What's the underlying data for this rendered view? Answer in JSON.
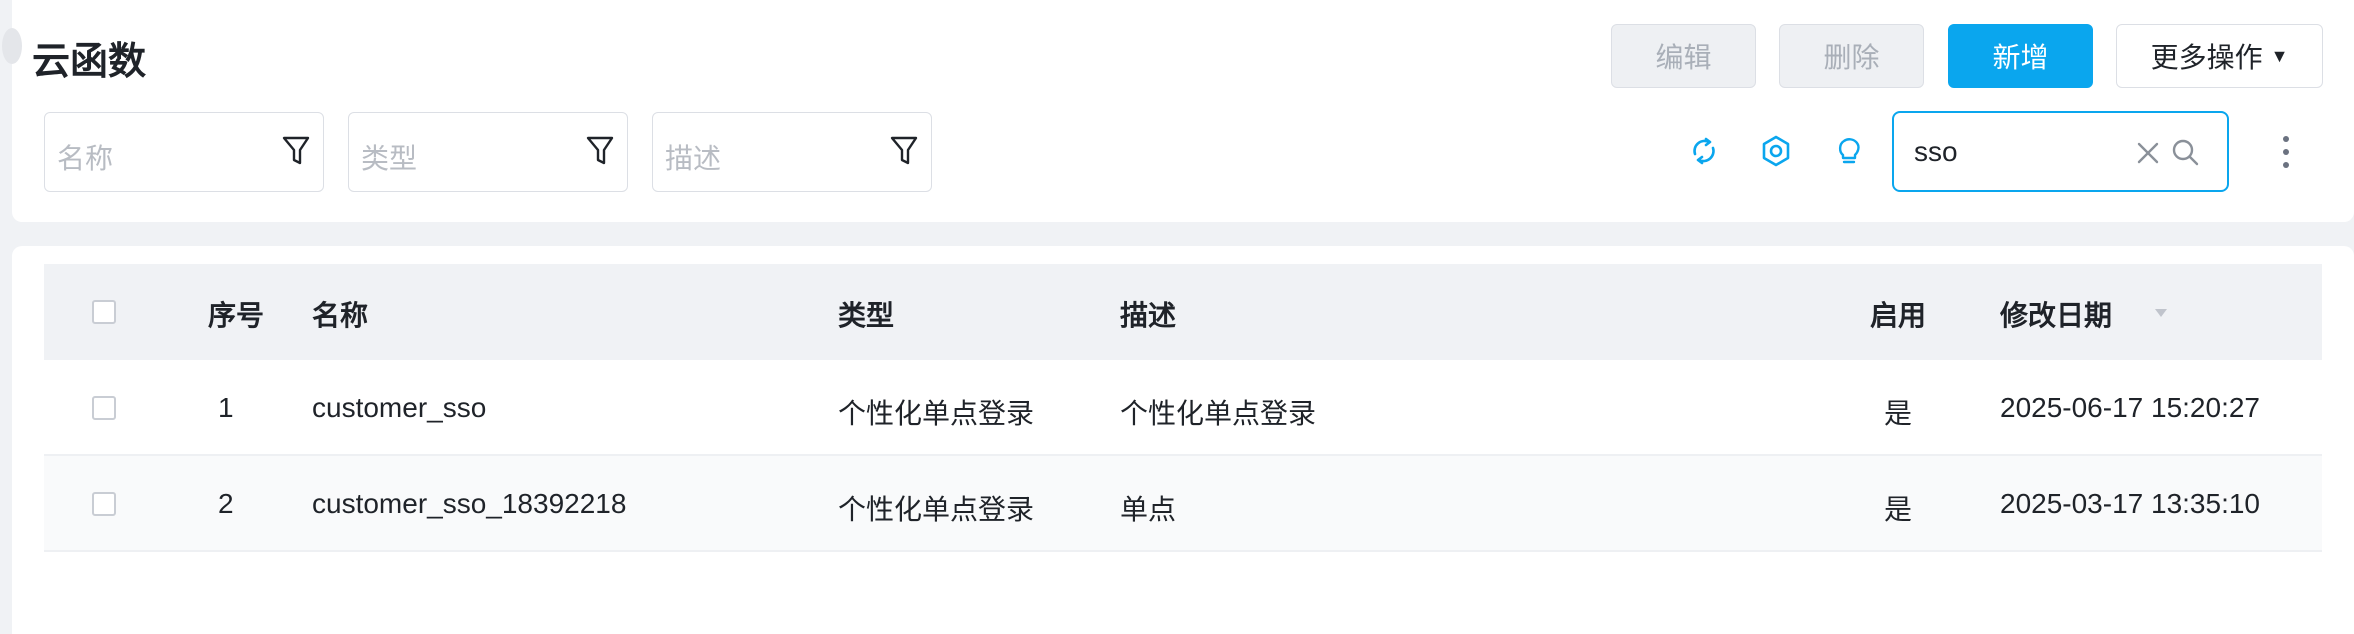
{
  "page": {
    "title": "云函数"
  },
  "toolbar": {
    "edit_label": "编辑",
    "delete_label": "删除",
    "add_label": "新增",
    "more_label": "更多操作",
    "more_caret": "▼"
  },
  "filters": [
    {
      "placeholder": "名称",
      "icon": "filter-icon"
    },
    {
      "placeholder": "类型",
      "icon": "filter-icon"
    },
    {
      "placeholder": "描述",
      "icon": "filter-icon"
    }
  ],
  "tools": {
    "icons": [
      "refresh-icon",
      "settings-icon",
      "lightbulb-icon"
    ],
    "accent": "#0aa6ee"
  },
  "search": {
    "value": "sso",
    "icons": [
      "clear-icon",
      "search-icon"
    ]
  },
  "table": {
    "columns": [
      "序号",
      "名称",
      "类型",
      "描述",
      "启用",
      "修改日期"
    ],
    "sort_column": "修改日期",
    "rows": [
      {
        "index": "1",
        "name": "customer_sso",
        "type": "个性化单点登录",
        "desc": "个性化单点登录",
        "enabled": "是",
        "modified": "2025-06-17 15:20:27"
      },
      {
        "index": "2",
        "name": "customer_sso_18392218",
        "type": "个性化单点登录",
        "desc": "单点",
        "enabled": "是",
        "modified": "2025-03-17 13:35:10"
      }
    ]
  }
}
